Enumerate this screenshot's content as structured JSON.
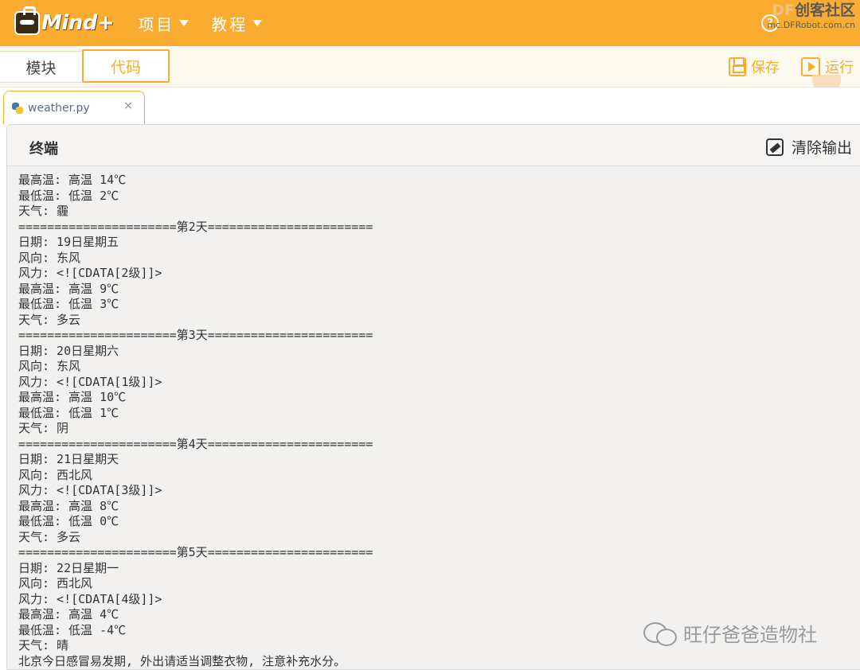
{
  "app": {
    "logo_text": "Mind+",
    "menu": [
      {
        "label": "项目"
      },
      {
        "label": "教程"
      }
    ],
    "help_symbol": "?",
    "watermark": {
      "prefix": "DF",
      "name": "创客社区",
      "url": "mc.DFRobot.com.cn"
    }
  },
  "mode_tabs": {
    "blocks": "模块",
    "code": "代码"
  },
  "toolbar": {
    "save_label": "保存",
    "run_label": "运行"
  },
  "file_tab": {
    "name": "weather.py",
    "close": "×"
  },
  "terminal": {
    "title": "终端",
    "clear_label": "清除输出",
    "lines": [
      "最高温: 高温 14℃",
      "最低温: 低温 2℃",
      "天气: 霾",
      "======================第2天=======================",
      "日期: 19日星期五",
      "风向: 东风",
      "风力: <![CDATA[2级]]>",
      "最高温: 高温 9℃",
      "最低温: 低温 3℃",
      "天气: 多云",
      "======================第3天=======================",
      "日期: 20日星期六",
      "风向: 东风",
      "风力: <![CDATA[1级]]>",
      "最高温: 高温 10℃",
      "最低温: 低温 1℃",
      "天气: 阴",
      "======================第4天=======================",
      "日期: 21日星期天",
      "风向: 西北风",
      "风力: <![CDATA[3级]]>",
      "最高温: 高温 8℃",
      "最低温: 低温 0℃",
      "天气: 多云",
      "======================第5天=======================",
      "日期: 22日星期一",
      "风向: 西北风",
      "风力: <![CDATA[4级]]>",
      "最高温: 高温 4℃",
      "最低温: 低温 -4℃",
      "天气: 晴",
      "北京今日感冒易发期, 外出请适当调整衣物, 注意补充水分。"
    ]
  },
  "bottom_watermark": "旺仔爸爸造物社",
  "colors": {
    "brand_orange": "#f9ac2f",
    "terminal_bg": "#f2f1ef"
  }
}
